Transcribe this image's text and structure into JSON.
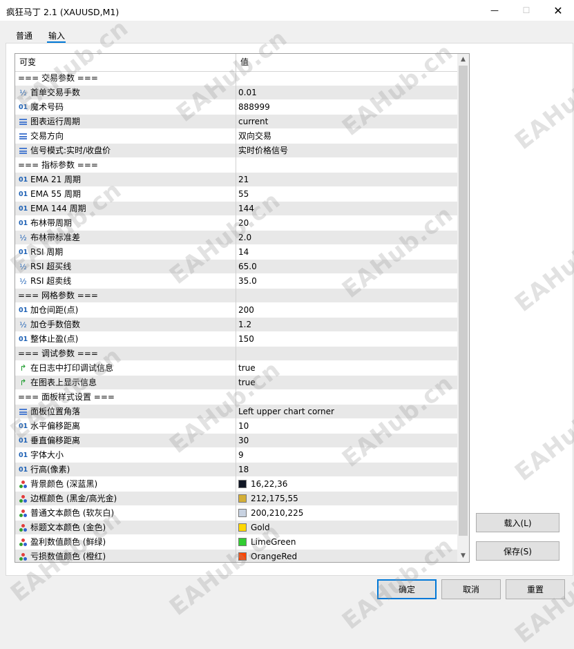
{
  "window": {
    "title": "疯狂马丁 2.1 (XAUUSD,M1)",
    "min": "—",
    "max": "☐",
    "close": "✕"
  },
  "tabs": [
    {
      "label": "普通"
    },
    {
      "label": "输入"
    }
  ],
  "grid": {
    "headers": {
      "variable": "可变",
      "value": "值"
    },
    "rows": [
      {
        "type": "section",
        "name": "=== 交易参数 ===",
        "value": ""
      },
      {
        "type": "double",
        "name": "首单交易手数",
        "value": "0.01"
      },
      {
        "type": "int",
        "name": "魔术号码",
        "value": "888999"
      },
      {
        "type": "enum",
        "name": "图表运行周期",
        "value": "current"
      },
      {
        "type": "enum",
        "name": "交易方向",
        "value": "双向交易"
      },
      {
        "type": "enum",
        "name": "信号模式:实时/收盘价",
        "value": "实时价格信号"
      },
      {
        "type": "section",
        "name": "=== 指标参数 ===",
        "value": ""
      },
      {
        "type": "int",
        "name": "EMA 21 周期",
        "value": "21"
      },
      {
        "type": "int",
        "name": "EMA 55 周期",
        "value": "55"
      },
      {
        "type": "int",
        "name": "EMA 144 周期",
        "value": "144"
      },
      {
        "type": "int",
        "name": "布林带周期",
        "value": "20"
      },
      {
        "type": "double",
        "name": "布林带标准差",
        "value": "2.0"
      },
      {
        "type": "int",
        "name": "RSI 周期",
        "value": "14"
      },
      {
        "type": "double",
        "name": "RSI 超买线",
        "value": "65.0"
      },
      {
        "type": "double",
        "name": "RSI 超卖线",
        "value": "35.0"
      },
      {
        "type": "section",
        "name": "=== 网格参数 ===",
        "value": ""
      },
      {
        "type": "int",
        "name": "加仓间距(点)",
        "value": "200"
      },
      {
        "type": "double",
        "name": "加仓手数倍数",
        "value": "1.2"
      },
      {
        "type": "int",
        "name": "整体止盈(点)",
        "value": "150"
      },
      {
        "type": "section",
        "name": "=== 调试参数 ===",
        "value": ""
      },
      {
        "type": "bool",
        "name": "在日志中打印调试信息",
        "value": "true"
      },
      {
        "type": "bool",
        "name": "在图表上显示信息",
        "value": "true"
      },
      {
        "type": "section",
        "name": "=== 面板样式设置 ===",
        "value": ""
      },
      {
        "type": "enum",
        "name": "面板位置角落",
        "value": "Left upper chart corner"
      },
      {
        "type": "int",
        "name": "水平偏移距离",
        "value": "10"
      },
      {
        "type": "int",
        "name": "垂直偏移距离",
        "value": "30"
      },
      {
        "type": "int",
        "name": "字体大小",
        "value": "9"
      },
      {
        "type": "int",
        "name": "行高(像素)",
        "value": "18"
      },
      {
        "type": "color",
        "name": "背景颜色 (深蓝黑)",
        "value": "16,22,36",
        "swatch": "#101624"
      },
      {
        "type": "color",
        "name": "边框颜色 (黑金/高光金)",
        "value": "212,175,55",
        "swatch": "#d4af37"
      },
      {
        "type": "color",
        "name": "普通文本颜色 (软灰白)",
        "value": "200,210,225",
        "swatch": "#c8d2e1"
      },
      {
        "type": "color",
        "name": "标题文本颜色 (金色)",
        "value": "Gold",
        "swatch": "#ffd700"
      },
      {
        "type": "color",
        "name": "盈利数值颜色 (鲜绿)",
        "value": "LimeGreen",
        "swatch": "#32cd32"
      },
      {
        "type": "color",
        "name": "亏损数值颜色 (橙红)",
        "value": "OrangeRed",
        "swatch": "#ff4500"
      }
    ]
  },
  "icons": {
    "int": "01",
    "double": "½",
    "enum": "enum-list-icon",
    "bool": "↱",
    "color": "palette-icon"
  },
  "scrollbar": {
    "up": "▲",
    "down": "▼"
  },
  "buttons": {
    "load": "载入(L)",
    "save": "保存(S)",
    "ok": "确定",
    "cancel": "取消",
    "reset": "重置"
  },
  "watermark": "EAHub.cn",
  "colors": {
    "accent": "#0078d7",
    "row_alt": "#e8e8e8"
  }
}
